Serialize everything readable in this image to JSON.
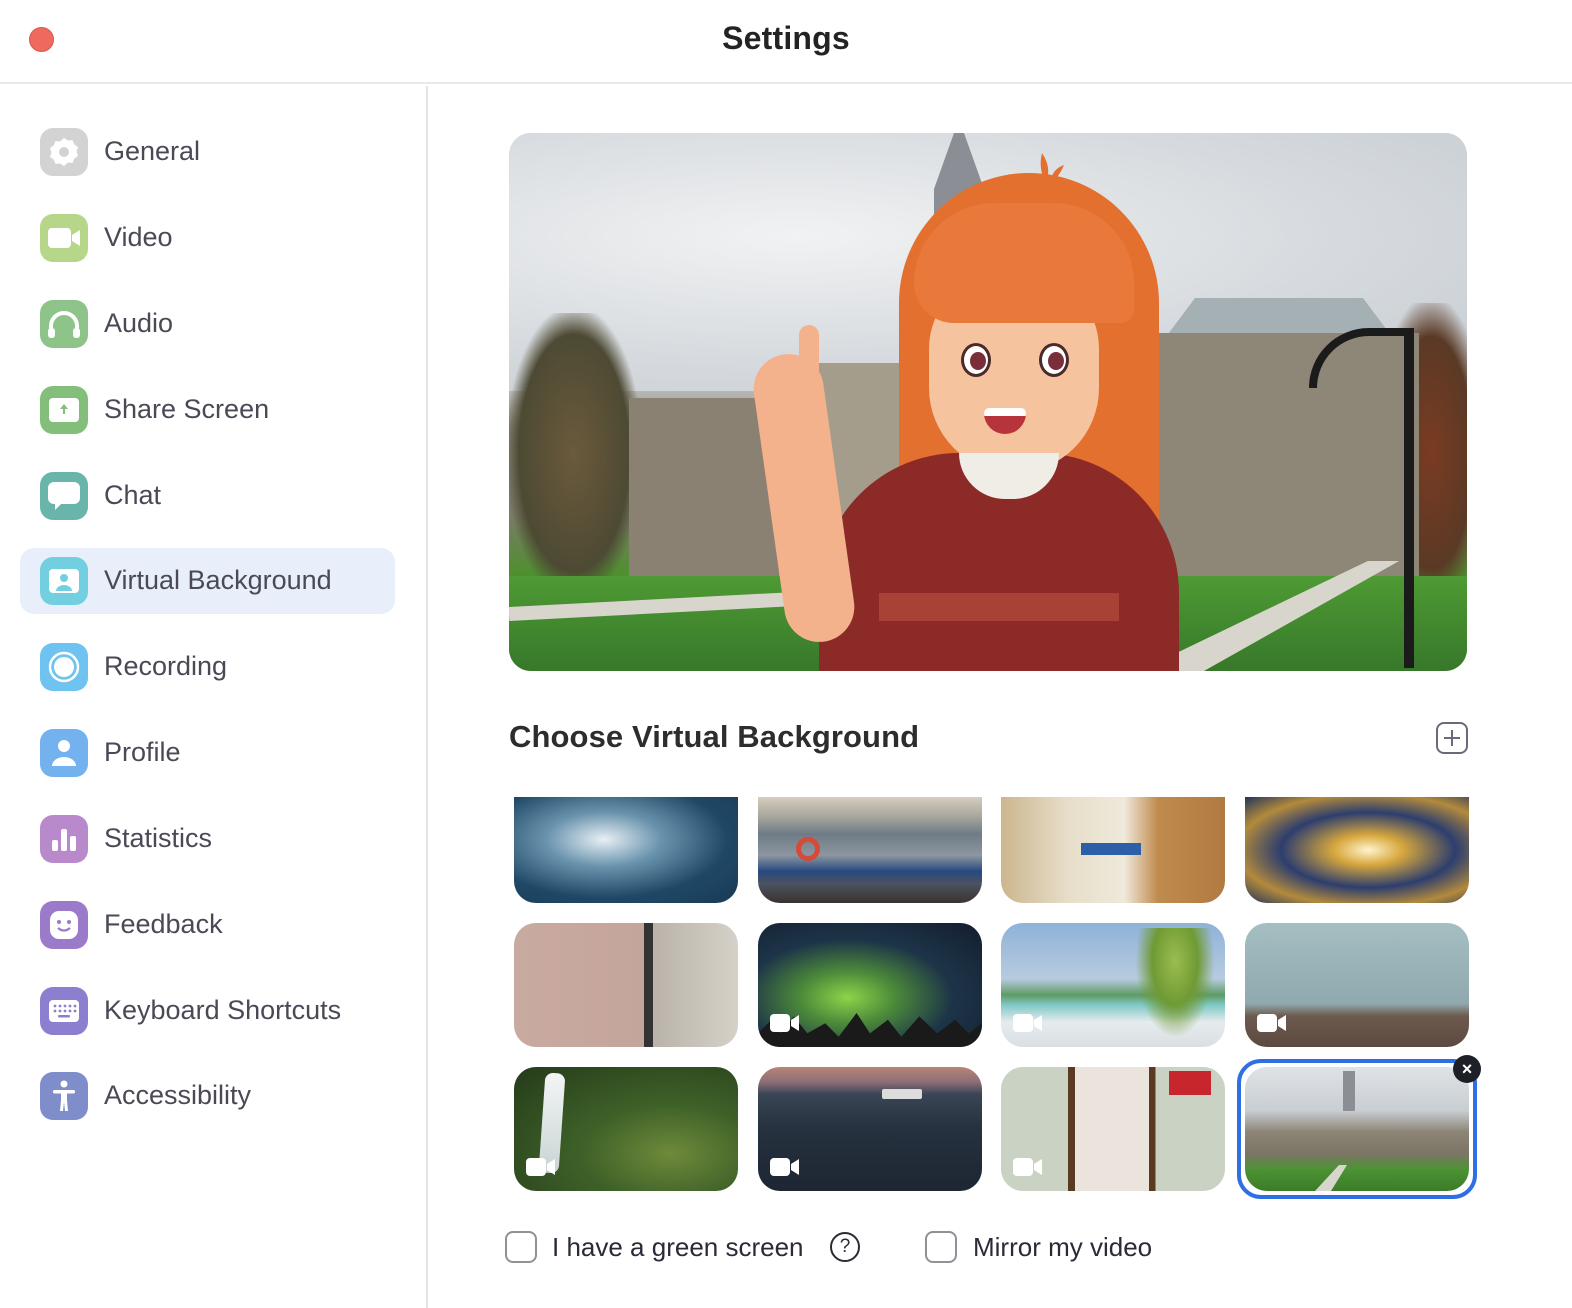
{
  "window": {
    "title": "Settings"
  },
  "sidebar": {
    "active": "Virtual Background",
    "items": [
      {
        "label": "General",
        "icon": "gear-icon",
        "color": "#d3d3d3"
      },
      {
        "label": "Video",
        "icon": "video-camera-icon",
        "color": "#b6d78a"
      },
      {
        "label": "Audio",
        "icon": "headphones-icon",
        "color": "#8ec48a"
      },
      {
        "label": "Share Screen",
        "icon": "share-screen-icon",
        "color": "#83bf7a"
      },
      {
        "label": "Chat",
        "icon": "chat-bubble-icon",
        "color": "#6ab5ab"
      },
      {
        "label": "Virtual Background",
        "icon": "virtual-background-icon",
        "color": "#72cfe0"
      },
      {
        "label": "Recording",
        "icon": "record-icon",
        "color": "#6ec3f0"
      },
      {
        "label": "Profile",
        "icon": "person-icon",
        "color": "#73b1ef"
      },
      {
        "label": "Statistics",
        "icon": "bar-chart-icon",
        "color": "#b98acb"
      },
      {
        "label": "Feedback",
        "icon": "smiley-icon",
        "color": "#9a7ac9"
      },
      {
        "label": "Keyboard Shortcuts",
        "icon": "keyboard-icon",
        "color": "#8c7fd0"
      },
      {
        "label": "Accessibility",
        "icon": "accessibility-icon",
        "color": "#7f8ecb"
      }
    ]
  },
  "main": {
    "preview_alt": "Video preview with virtual background: campus building with cartoon avatar",
    "section_title": "Choose Virtual Background",
    "add_button_label": "+",
    "backgrounds": [
      {
        "name": "Ocean waves",
        "is_video": false,
        "selected": false
      },
      {
        "name": "Cruise ship deck",
        "is_video": false,
        "selected": false
      },
      {
        "name": "Cabin bedroom",
        "is_video": false,
        "selected": false
      },
      {
        "name": "Exploding TARDIS painting",
        "is_video": false,
        "selected": false
      },
      {
        "name": "Office wall with blinds",
        "is_video": false,
        "selected": false
      },
      {
        "name": "Northern lights",
        "is_video": true,
        "selected": false
      },
      {
        "name": "Tropical beach",
        "is_video": true,
        "selected": false
      },
      {
        "name": "Room with couch",
        "is_video": true,
        "selected": false
      },
      {
        "name": "Waterfall",
        "is_video": true,
        "selected": false
      },
      {
        "name": "Ocean sunset with ship",
        "is_video": true,
        "selected": false
      },
      {
        "name": "Door with Coca-Cola sign",
        "is_video": true,
        "selected": false
      },
      {
        "name": "Campus building",
        "is_video": false,
        "selected": true
      }
    ],
    "remove_label": "×",
    "options": {
      "green_screen_label": "I have a green screen",
      "green_screen_checked": false,
      "help_label": "?",
      "mirror_label": "Mirror my video",
      "mirror_checked": false
    }
  },
  "colors": {
    "accent": "#2f6fe4",
    "active_item_bg": "#e8effb",
    "close_button": "#ee6a5f"
  }
}
